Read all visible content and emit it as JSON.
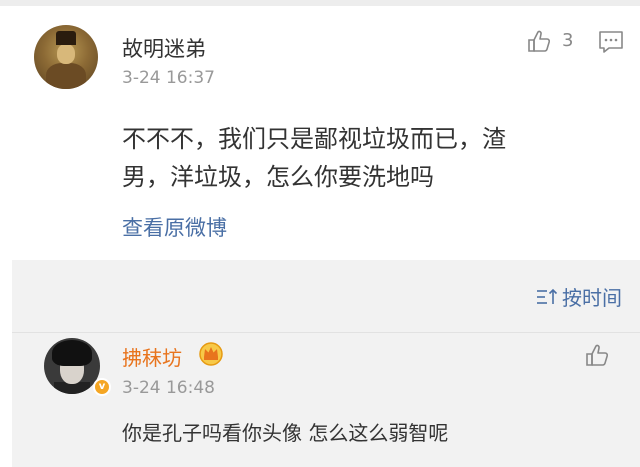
{
  "comment": {
    "author": "故明迷弟",
    "timestamp": "3-24 16:37",
    "like_count": "3",
    "text_line1": "不不不，我们只是鄙视垃圾而已，渣",
    "text_line2": "男，洋垃圾，怎么你要洗地吗",
    "view_original": "查看原微博",
    "icons": {
      "like": "thumbs-up-icon",
      "reply": "comment-icon"
    }
  },
  "replies": {
    "sort_label": "按时间",
    "sort_icon": "sort-icon",
    "items": [
      {
        "author": "拂秣坊",
        "timestamp": "3-24 16:48",
        "text": "你是孔子吗看你头像 怎么这么弱智呢",
        "author_color": "#e8741d",
        "badges": [
          "crown-icon",
          "verified-badge-icon"
        ]
      }
    ]
  },
  "colors": {
    "link": "#4a6fa5",
    "timestamp": "#999999",
    "reply_background": "#f2f2f2"
  }
}
